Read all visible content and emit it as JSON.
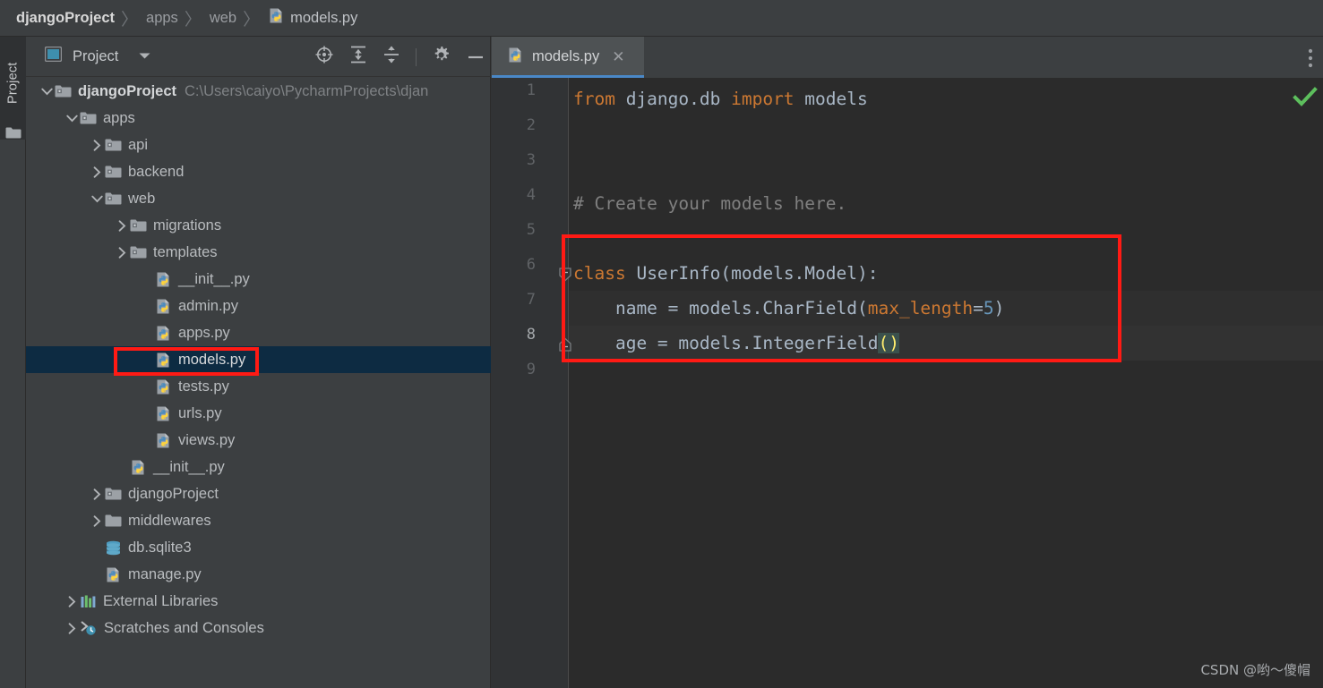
{
  "window": {
    "title": "djangoProject – models.py",
    "theme": "darcula",
    "colors": {
      "panel_bg": "#3c3f41",
      "editor_bg": "#2b2b2b",
      "gutter_bg": "#313335",
      "selected_row_bg": "#0d2b42",
      "tab_active_bg": "#4e5254",
      "tab_underline": "#4a88c7",
      "annotation_red": "#ff1a14",
      "keyword_orange": "#cc7832",
      "number_blue": "#6897bb",
      "text_default": "#a9b7c6",
      "comment_grey": "#808080",
      "paren_match_bg": "#3b514d",
      "paren_match_fg": "#ffee6e",
      "status_ok_green": "#5dbf5d"
    }
  },
  "breadcrumb": {
    "items": [
      {
        "label": "djangoProject",
        "icon": null,
        "bold": true
      },
      {
        "label": "apps",
        "icon": null,
        "bold": false
      },
      {
        "label": "web",
        "icon": null,
        "bold": false
      },
      {
        "label": "models.py",
        "icon": "python-file-icon",
        "bold": false
      }
    ],
    "separator": "〉"
  },
  "tool_strip": {
    "label": "Project",
    "icon": "folder-icon"
  },
  "project_panel": {
    "title": "Project",
    "title_icon": "project-view-icon",
    "dropdown_icon": "chevron-down-icon",
    "tools": [
      {
        "name": "scroll-from-source-icon",
        "tooltip": "Select Opened File"
      },
      {
        "name": "expand-all-icon",
        "tooltip": "Expand All"
      },
      {
        "name": "collapse-all-icon",
        "tooltip": "Collapse All"
      },
      {
        "name": "gear-icon",
        "tooltip": "Options"
      },
      {
        "name": "minimize-icon",
        "tooltip": "Hide"
      }
    ],
    "tree": [
      {
        "label": "djangoProject",
        "path": "C:\\Users\\caiyo\\PycharmProjects\\djan",
        "icon": "project-folder-icon",
        "arrow": "expanded",
        "depth": 0,
        "selected": false,
        "bold": true
      },
      {
        "label": "apps",
        "path": "",
        "icon": "source-folder-icon",
        "arrow": "expanded",
        "depth": 1,
        "selected": false,
        "bold": false
      },
      {
        "label": "api",
        "path": "",
        "icon": "source-folder-icon",
        "arrow": "collapsed",
        "depth": 2,
        "selected": false,
        "bold": false
      },
      {
        "label": "backend",
        "path": "",
        "icon": "source-folder-icon",
        "arrow": "collapsed",
        "depth": 2,
        "selected": false,
        "bold": false
      },
      {
        "label": "web",
        "path": "",
        "icon": "source-folder-icon",
        "arrow": "expanded",
        "depth": 2,
        "selected": false,
        "bold": false
      },
      {
        "label": "migrations",
        "path": "",
        "icon": "source-folder-icon",
        "arrow": "collapsed",
        "depth": 3,
        "selected": false,
        "bold": false
      },
      {
        "label": "templates",
        "path": "",
        "icon": "source-folder-icon",
        "arrow": "collapsed",
        "depth": 3,
        "selected": false,
        "bold": false
      },
      {
        "label": "__init__.py",
        "path": "",
        "icon": "python-file-icon",
        "arrow": "none",
        "depth": 4,
        "selected": false,
        "bold": false
      },
      {
        "label": "admin.py",
        "path": "",
        "icon": "python-file-icon",
        "arrow": "none",
        "depth": 4,
        "selected": false,
        "bold": false
      },
      {
        "label": "apps.py",
        "path": "",
        "icon": "python-file-icon",
        "arrow": "none",
        "depth": 4,
        "selected": false,
        "bold": false
      },
      {
        "label": "models.py",
        "path": "",
        "icon": "python-file-icon",
        "arrow": "none",
        "depth": 4,
        "selected": true,
        "bold": false
      },
      {
        "label": "tests.py",
        "path": "",
        "icon": "python-file-icon",
        "arrow": "none",
        "depth": 4,
        "selected": false,
        "bold": false
      },
      {
        "label": "urls.py",
        "path": "",
        "icon": "python-file-icon",
        "arrow": "none",
        "depth": 4,
        "selected": false,
        "bold": false
      },
      {
        "label": "views.py",
        "path": "",
        "icon": "python-file-icon",
        "arrow": "none",
        "depth": 4,
        "selected": false,
        "bold": false
      },
      {
        "label": "__init__.py",
        "path": "",
        "icon": "python-file-icon",
        "arrow": "none",
        "depth": 3,
        "selected": false,
        "bold": false
      },
      {
        "label": "djangoProject",
        "path": "",
        "icon": "source-folder-icon",
        "arrow": "collapsed",
        "depth": 2,
        "selected": false,
        "bold": false
      },
      {
        "label": "middlewares",
        "path": "",
        "icon": "plain-folder-icon",
        "arrow": "collapsed",
        "depth": 2,
        "selected": false,
        "bold": false
      },
      {
        "label": "db.sqlite3",
        "path": "",
        "icon": "database-icon",
        "arrow": "none",
        "depth": 2,
        "selected": false,
        "bold": false
      },
      {
        "label": "manage.py",
        "path": "",
        "icon": "python-file-icon",
        "arrow": "none",
        "depth": 2,
        "selected": false,
        "bold": false
      },
      {
        "label": "External Libraries",
        "path": "",
        "icon": "libraries-icon",
        "arrow": "collapsed",
        "depth": 1,
        "selected": false,
        "bold": false
      },
      {
        "label": "Scratches and Consoles",
        "path": "",
        "icon": "scratches-icon",
        "arrow": "collapsed",
        "depth": 1,
        "selected": false,
        "bold": false
      }
    ]
  },
  "editor": {
    "tabs": [
      {
        "label": "models.py",
        "icon": "python-file-icon",
        "close_icon": "close-icon",
        "active": true
      }
    ],
    "tab_overflow_icon": "more-vertical-icon",
    "inspection_status_icon": "check-icon",
    "current_line": 8,
    "line_numbers": [
      1,
      2,
      3,
      4,
      5,
      6,
      7,
      8,
      9
    ],
    "code_lines": [
      {
        "n": 1,
        "tokens": [
          {
            "t": "from ",
            "c": "kw"
          },
          {
            "t": "django.db ",
            "c": ""
          },
          {
            "t": "import ",
            "c": "kw"
          },
          {
            "t": "models",
            "c": ""
          }
        ]
      },
      {
        "n": 2,
        "tokens": []
      },
      {
        "n": 3,
        "tokens": []
      },
      {
        "n": 4,
        "tokens": [
          {
            "t": "# Create your models here.",
            "c": "cmt"
          }
        ]
      },
      {
        "n": 5,
        "tokens": []
      },
      {
        "n": 6,
        "tokens": [
          {
            "t": "class ",
            "c": "kw"
          },
          {
            "t": "UserInfo(models.Model):",
            "c": ""
          }
        ]
      },
      {
        "n": 7,
        "tokens": [
          {
            "t": "    name = models.CharField(",
            "c": ""
          },
          {
            "t": "max_length",
            "c": "kwarg"
          },
          {
            "t": "=",
            "c": ""
          },
          {
            "t": "5",
            "c": "num"
          },
          {
            "t": ")",
            "c": ""
          }
        ]
      },
      {
        "n": 8,
        "tokens": [
          {
            "t": "    age = models.IntegerField",
            "c": ""
          },
          {
            "t": "()",
            "c": "paren-hl"
          }
        ]
      },
      {
        "n": 9,
        "tokens": []
      }
    ],
    "plain_text": "from django.db import models\n\n\n# Create your models here.\n\nclass UserInfo(models.Model):\n    name = models.CharField(max_length=5)\n    age = models.IntegerField()\n",
    "fold_markers": [
      {
        "line": 6,
        "type": "fold-open-icon"
      },
      {
        "line": 8,
        "type": "fold-end-icon"
      }
    ]
  },
  "annotations": [
    {
      "name": "models-py-tree-highlight",
      "target": "models.py tree row"
    },
    {
      "name": "model-class-code-highlight",
      "target": "UserInfo class definition block"
    }
  ],
  "watermark": {
    "text": "CSDN @哟～傻帽"
  }
}
